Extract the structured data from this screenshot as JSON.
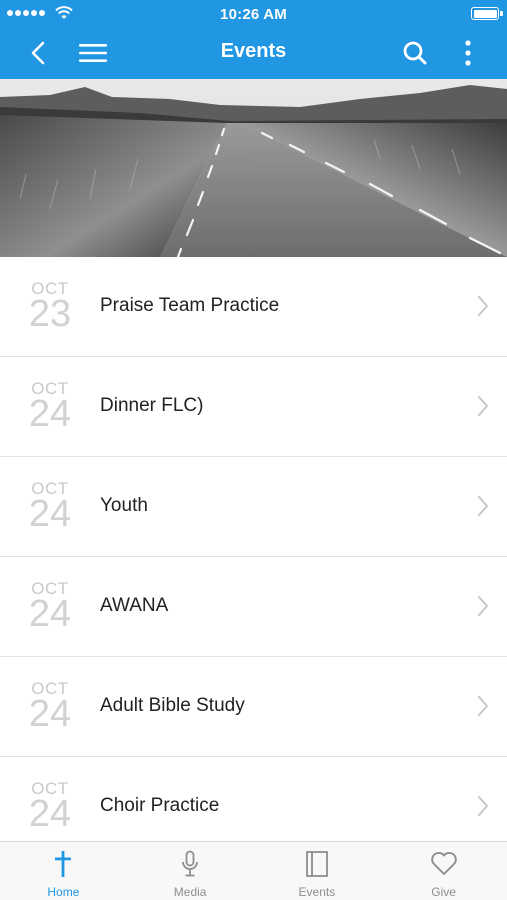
{
  "status_bar": {
    "time": "10:26 AM"
  },
  "nav": {
    "title": "Events"
  },
  "events": [
    {
      "month": "OCT",
      "day": "23",
      "title": "Praise Team Practice"
    },
    {
      "month": "OCT",
      "day": "24",
      "title": "Dinner FLC)"
    },
    {
      "month": "OCT",
      "day": "24",
      "title": "Youth"
    },
    {
      "month": "OCT",
      "day": "24",
      "title": "AWANA"
    },
    {
      "month": "OCT",
      "day": "24",
      "title": "Adult Bible Study"
    },
    {
      "month": "OCT",
      "day": "24",
      "title": "Choir Practice"
    }
  ],
  "tabs": [
    {
      "label": "Home",
      "icon": "cross-icon",
      "active": true
    },
    {
      "label": "Media",
      "icon": "microphone-icon",
      "active": false
    },
    {
      "label": "Events",
      "icon": "book-icon",
      "active": false
    },
    {
      "label": "Give",
      "icon": "heart-icon",
      "active": false
    }
  ],
  "colors": {
    "accent": "#2196e3",
    "tab_inactive": "#8e8e8e"
  }
}
